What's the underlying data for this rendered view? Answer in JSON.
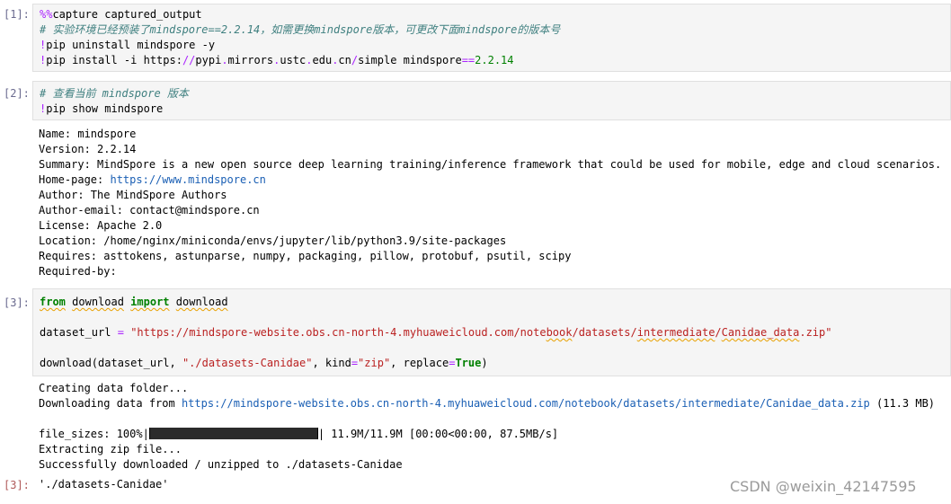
{
  "cell1": {
    "prompt": "[1]:",
    "magic": "%%",
    "line1_rest": "capture captured_output",
    "comment": "# 实验环境已经预装了mindspore==2.2.14，如需更换mindspore版本，可更改下面mindspore的版本号",
    "bang1": "!",
    "line3_rest": "pip uninstall mindspore -y",
    "bang2": "!",
    "line4_a": "pip install -i https:",
    "line4_b": "//",
    "line4_c": "pypi",
    "line4_d": ".",
    "line4_e": "mirrors",
    "line4_f": ".",
    "line4_g": "ustc",
    "line4_h": ".",
    "line4_i": "edu",
    "line4_j": ".",
    "line4_k": "cn",
    "line4_l": "/",
    "line4_m": "simple mindspore",
    "line4_n": "==",
    "line4_o": "2.2.14"
  },
  "cell2": {
    "prompt": "[2]:",
    "comment": "# 查看当前 mindspore 版本",
    "bang": "!",
    "line2_rest": "pip show mindspore",
    "output": {
      "name": "Name: mindspore",
      "version": "Version: 2.2.14",
      "summary": "Summary: MindSpore is a new open source deep learning training/inference framework that could be used for mobile, edge and cloud scenarios.",
      "homepage_label": "Home-page: ",
      "homepage_url": "https://www.mindspore.cn",
      "author": "Author: The MindSpore Authors",
      "author_email": "Author-email: contact@mindspore.cn",
      "license": "License: Apache 2.0",
      "location": "Location: /home/nginx/miniconda/envs/jupyter/lib/python3.9/site-packages",
      "requires": "Requires: asttokens, astunparse, numpy, packaging, pillow, protobuf, psutil, scipy",
      "required_by": "Required-by:"
    }
  },
  "cell3": {
    "prompt": "[3]:",
    "kw_from": "from",
    "mod": "download",
    "kw_import": "import",
    "name": "download",
    "var": "dataset_url",
    "eq": "=",
    "url_str_a": "\"https://mindspore-website.obs.cn-north-4.myhuaweicloud.com/note",
    "url_str_b": "book",
    "url_str_c": "/datasets/",
    "url_str_d": "intermediate",
    "url_str_e": "/",
    "url_str_f": "Canidae_data",
    "url_str_g": ".zip\"",
    "call_a": "download(dataset_url, ",
    "call_str1": "\"./datasets-Canidae\"",
    "call_b": ", kind",
    "call_eq1": "=",
    "call_str2": "\"zip\"",
    "call_c": ", replace",
    "call_eq2": "=",
    "call_true": "True",
    "call_d": ")",
    "output": {
      "creating": "Creating data folder...",
      "downloading_label": "Downloading data from ",
      "downloading_url": "https://mindspore-website.obs.cn-north-4.myhuaweicloud.com/notebook/datasets/intermediate/Canidae_data.zip",
      "downloading_size": " (11.3 MB)",
      "file_sizes_label": "file_sizes: 100%|",
      "file_sizes_rest": "| 11.9M/11.9M [00:00<00:00, 87.5MB/s]",
      "extracting": "Extracting zip file...",
      "success": "Successfully downloaded / unzipped to ./datasets-Canidae"
    },
    "result_prompt": "[3]:",
    "result": "'./datasets-Canidae'"
  },
  "watermark": "CSDN @weixin_42147595"
}
